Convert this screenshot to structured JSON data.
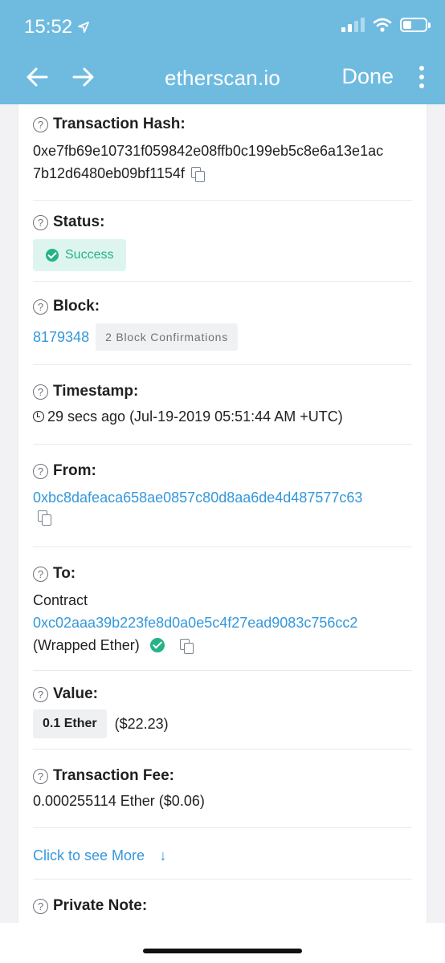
{
  "status_bar": {
    "time": "15:52"
  },
  "nav": {
    "title": "etherscan.io",
    "done_label": "Done"
  },
  "colors": {
    "accent": "#6fbbe0",
    "link": "#3498db",
    "success": "#23b387"
  },
  "tx": {
    "hash": {
      "label": "Transaction Hash:",
      "line1": "0xe7fb69e10731f059842e08ffb0c199eb5c8e6a13e1ac",
      "line2": "7b12d6480eb09bf1154f"
    },
    "status": {
      "label": "Status:",
      "value": "Success"
    },
    "block": {
      "label": "Block:",
      "number": "8179348",
      "confirmations": "2 Block Confirmations"
    },
    "timestamp": {
      "label": "Timestamp:",
      "value": "29 secs ago (Jul-19-2019 05:51:44 AM +UTC)"
    },
    "from": {
      "label": "From:",
      "address": "0xbc8dafeaca658ae0857c80d8aa6de4d487577c63"
    },
    "to": {
      "label": "To:",
      "prefix": "Contract",
      "address": "0xc02aaa39b223fe8d0a0e5c4f27ead9083c756cc2",
      "name": "(Wrapped Ether)"
    },
    "value": {
      "label": "Value:",
      "amount": "0.1 Ether",
      "usd": "($22.23)"
    },
    "fee": {
      "label": "Transaction Fee:",
      "value": "0.000255114 Ether ($0.06)"
    },
    "more_link": "Click to see More",
    "note": {
      "label": "Private Note:"
    }
  }
}
